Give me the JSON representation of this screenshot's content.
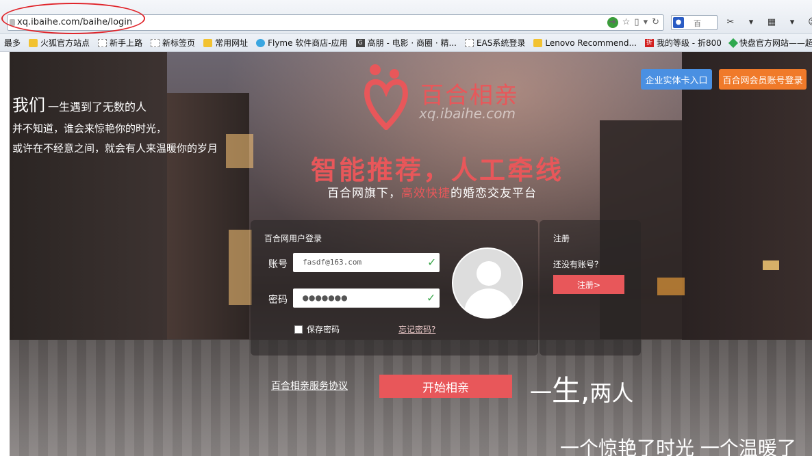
{
  "browser": {
    "url": "xq.ibaihe.com/baihe/login",
    "search_hint": "百",
    "bookmarks": [
      {
        "label": "最多",
        "icon": "none"
      },
      {
        "label": "火狐官方站点",
        "icon": "folder"
      },
      {
        "label": "新手上路",
        "icon": "page"
      },
      {
        "label": "新标签页",
        "icon": "page"
      },
      {
        "label": "常用网址",
        "icon": "folder"
      },
      {
        "label": "Flyme 软件商店-应用",
        "icon": "round"
      },
      {
        "label": "高朋 - 电影 · 商圈 · 精...",
        "icon": "g"
      },
      {
        "label": "EAS系统登录",
        "icon": "page"
      },
      {
        "label": "Lenovo Recommend...",
        "icon": "folder"
      },
      {
        "label": "我的等级 - 折800",
        "icon": "zhe"
      },
      {
        "label": "快盘官方网站——超...",
        "icon": "diamond"
      }
    ]
  },
  "hero": {
    "poem_line1_big": "我们",
    "poem_line1_small": "一生遇到了无数的人",
    "poem_line2": "并不知道，谁会来惊艳你的时光，",
    "poem_line3": "或许在不经意之间，就会有人来温暖你的岁月",
    "brand_name": "百合相亲",
    "brand_domain": "xq.ibaihe.com",
    "slogan": "智能推荐，人工牵线",
    "sub_slogan_prefix": "百合网旗下，",
    "sub_slogan_highlight": "高效快捷",
    "sub_slogan_suffix": "的婚恋交友平台"
  },
  "top_buttons": {
    "enterprise": "企业实体卡入口",
    "baihe_login": "百合网会员账号登录"
  },
  "login": {
    "title": "百合网用户登录",
    "account_label": "账号",
    "account_value": "fasdf@163.com",
    "password_label": "密码",
    "password_value": "●●●●●●●",
    "remember_label": "保存密码",
    "forgot_label": "忘记密码?"
  },
  "register": {
    "title": "注册",
    "question": "还没有账号？",
    "button": "注册>"
  },
  "footer": {
    "agreement": "百合相亲服务协议",
    "start_button": "开始相亲",
    "tagline_yi": "一",
    "tagline_sheng": "生",
    "tagline_comma": ",",
    "tagline_two": "两人",
    "tagline2": "一个惊艳了时光 一个温暖了"
  },
  "colors": {
    "brand_red": "#e8575a",
    "enterprise_blue": "#4a90e2",
    "baihe_orange": "#f07a2a",
    "annotation_red": "#e0242a"
  }
}
